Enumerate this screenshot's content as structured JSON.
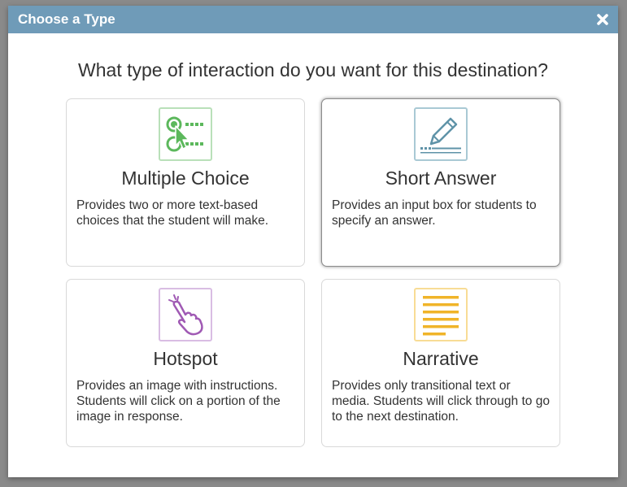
{
  "dialog": {
    "title": "Choose a Type",
    "close_icon": "close-x-icon",
    "question": "What type of interaction do you want for this destination?"
  },
  "cards": [
    {
      "title": "Multiple Choice",
      "description": "Provides two or more text-based choices that the student will make.",
      "icon": "multiple-choice-icon",
      "color": "#5cb85c",
      "selected": false
    },
    {
      "title": "Short Answer",
      "description": "Provides an input box for students to specify an answer.",
      "icon": "pencil-icon",
      "color": "#5f93a8",
      "selected": true
    },
    {
      "title": "Hotspot",
      "description": "Provides an image with instructions. Students will click on a portion of the image in response.",
      "icon": "tap-hand-icon",
      "color": "#a05ab4",
      "selected": false
    },
    {
      "title": "Narrative",
      "description": "Provides only transitional text or media. Students will click through to go to the next destination.",
      "icon": "text-lines-icon",
      "color": "#f0b429",
      "selected": false
    }
  ]
}
